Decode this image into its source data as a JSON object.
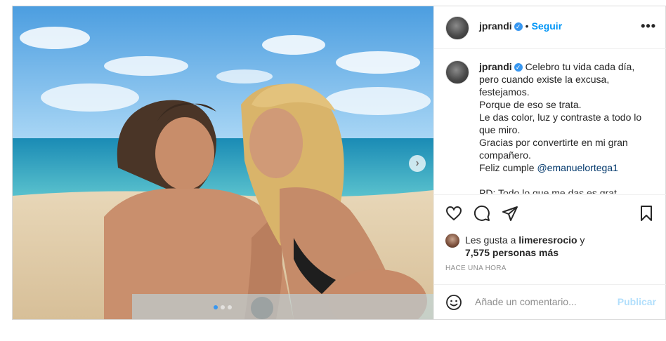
{
  "post": {
    "username": "jprandi",
    "follow_label": "Seguir",
    "bullet": "•",
    "more_label": "•••",
    "caption_lines": [
      "Celebro tu vida cada día,",
      "pero cuando existe la excusa,",
      "festejamos.",
      "Porque de eso se trata.",
      "Le das color, luz y contraste a todo lo",
      "que miro.",
      "Gracias por convertirte en mi gran",
      "compañero.",
      "Feliz cumple "
    ],
    "mention": "@emanuelortega1",
    "caption_clipped": "PD: Todo lo que me das es grat...",
    "likes_prefix": "Les gusta a ",
    "likes_user": "limeresrocio",
    "likes_and": " y",
    "likes_count": "7,575 personas más",
    "time": "HACE UNA HORA",
    "comment_placeholder": "Añade un comentario...",
    "publish_label": "Publicar"
  },
  "icons": {
    "verified": "verified-badge-icon",
    "next": "chevron-right-icon",
    "like": "heart-icon",
    "comment": "comment-icon",
    "share": "paper-plane-icon",
    "save": "bookmark-icon",
    "emoji": "emoji-icon"
  },
  "colors": {
    "accent": "#0095f6",
    "verified": "#3897f0",
    "publish_disabled": "#b2dffc",
    "muted": "#8e8e8e"
  },
  "carousel": {
    "slides": 3,
    "active": 1
  }
}
